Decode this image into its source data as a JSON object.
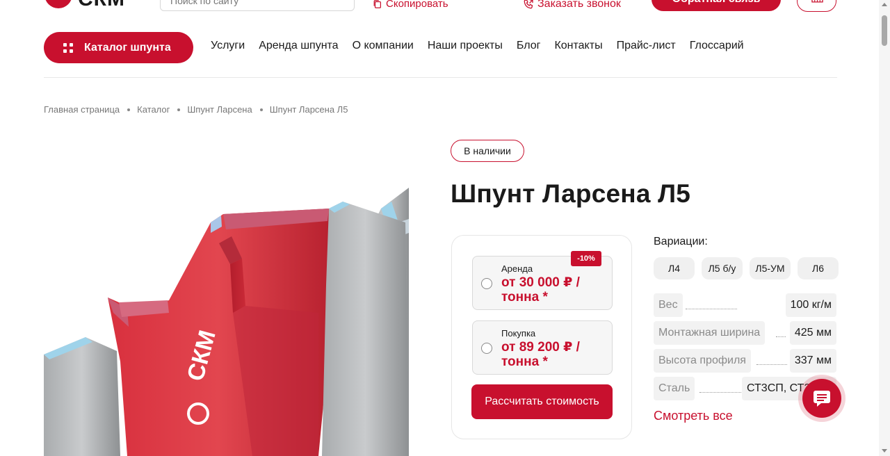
{
  "header": {
    "logo_text": "СКМ",
    "search_placeholder": "Поиск по сайту",
    "copy_label": "Скопировать",
    "call_label": "Заказать звонок",
    "feedback_label": "Обратная связь",
    "icons": {
      "search": "search-icon",
      "copy": "copy-icon",
      "call": "phone-icon",
      "cart": "cart-icon"
    }
  },
  "nav": {
    "catalog_label": "Каталог шпунта",
    "items": [
      "Услуги",
      "Аренда шпунта",
      "О компании",
      "Наши проекты",
      "Блог",
      "Контакты",
      "Прайс-лист",
      "Глоссарий"
    ]
  },
  "breadcrumb": [
    "Главная страница",
    "Каталог",
    "Шпунт Ларсена",
    "Шпунт Ларсена Л5"
  ],
  "product": {
    "stock_status": "В наличии",
    "title": "Шпунт Ларсена Л5",
    "price_options": [
      {
        "label": "Аренда",
        "price": "от 30 000 ₽ / тонна *",
        "badge": "-10%"
      },
      {
        "label": "Покупка",
        "price": "от 89 200 ₽ / тонна *"
      }
    ],
    "calc_button": "Рассчитать стоимость",
    "variations_label": "Вариации:",
    "variations": [
      "Л4",
      "Л5 б/у",
      "Л5-УМ",
      "Л6"
    ],
    "specs": [
      {
        "name": "Вес",
        "value": "100 кг/м"
      },
      {
        "name": "Монтажная ширина",
        "value": "425 мм"
      },
      {
        "name": "Высота профиля",
        "value": "337 мм"
      },
      {
        "name": "Сталь",
        "value": "СТ3СП, СТ3"
      }
    ],
    "see_all": "Смотреть все",
    "image_brand": "СКМ"
  },
  "colors": {
    "accent": "#c8102e",
    "text": "#1a1a1a",
    "muted": "#777777"
  }
}
